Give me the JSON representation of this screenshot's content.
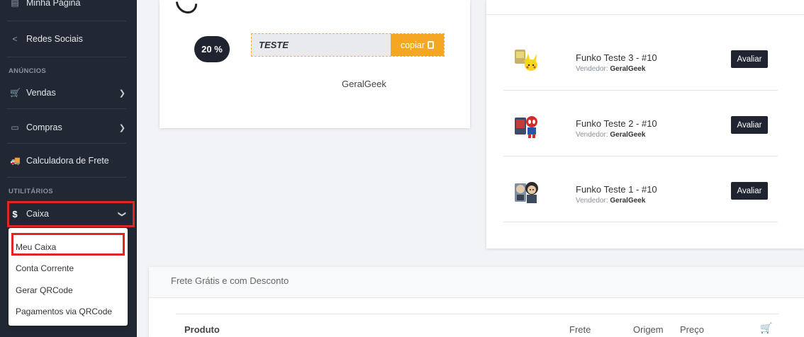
{
  "sidebar": {
    "top_item": "Minha Página",
    "redes": "Redes Sociais",
    "section_anuncios": "ANÚNCIOS",
    "vendas": "Vendas",
    "compras": "Compras",
    "calculadora": "Calculadora de Frete",
    "section_utilitarios": "UTILITÁRIOS",
    "caixa": "Caixa",
    "submenu": [
      "Meu Caixa",
      "Conta Corrente",
      "Gerar QRCode",
      "Pagamentos via QRCode"
    ]
  },
  "coupon": {
    "discount": "20 %",
    "code": "TESTE",
    "copy_label": "copiar",
    "seller": "GeralGeek"
  },
  "evaluations": {
    "vendor_prefix": "Vendedor:",
    "button": "Avaliar",
    "items": [
      {
        "title": "Funko Teste 3 - #10",
        "vendor": "GeralGeek",
        "icon": "pikachu-funko"
      },
      {
        "title": "Funko Teste 2 - #10",
        "vendor": "GeralGeek",
        "icon": "spiderman-funko"
      },
      {
        "title": "Funko Teste 1 - #10",
        "vendor": "GeralGeek",
        "icon": "figure-funko"
      }
    ]
  },
  "frete": {
    "title": "Frete Grátis e com Desconto",
    "columns": {
      "produto": "Produto",
      "frete": "Frete",
      "origem": "Origem",
      "preco": "Preço"
    }
  },
  "colors": {
    "accent": "#f5a623",
    "dark": "#1f2430",
    "highlight": "#e02525"
  }
}
